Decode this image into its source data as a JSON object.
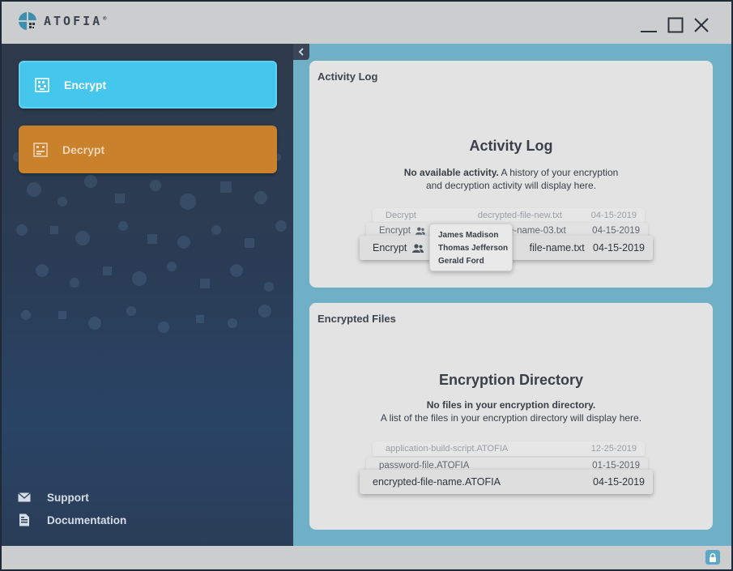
{
  "app": {
    "name": "ATOFIA",
    "registered": "®"
  },
  "window_controls": {
    "minimize": "minimize-icon",
    "maximize": "maximize-icon",
    "close": "close-icon"
  },
  "sidebar": {
    "items": [
      {
        "label": "Encrypt",
        "icon": "encrypt-icon",
        "color": "#45c6ec",
        "active": true
      },
      {
        "label": "Decrypt",
        "icon": "decrypt-icon",
        "color": "#c9822b",
        "active": false
      }
    ],
    "footer": [
      {
        "label": "Support",
        "icon": "mail-icon"
      },
      {
        "label": "Documentation",
        "icon": "document-icon"
      }
    ]
  },
  "activity": {
    "header": "Activity Log",
    "title": "Activity Log",
    "desc_bold": "No available activity.",
    "desc_line1_rest": " A history of your encryption",
    "desc_line2": "and decryption activity will display here.",
    "rows": [
      {
        "action": "Decrypt",
        "file": "decrypted-file-new.txt",
        "date": "04-15-2019"
      },
      {
        "action": "Encrypt",
        "file": "le-name-03.txt",
        "date": "04-15-2019"
      },
      {
        "action": "Encrypt",
        "file": "file-name.txt",
        "date": "04-15-2019"
      }
    ],
    "tooltip_names": [
      "James Madison",
      "Thomas Jefferson",
      "Gerald Ford"
    ]
  },
  "files": {
    "header": "Encrypted Files",
    "title": "Encryption Directory",
    "desc_bold": "No files in your encryption directory.",
    "desc_line2": "A list of the files in your encryption directory will display here.",
    "rows": [
      {
        "file": "application-build-script.ATOFIA",
        "date": "12-25-2019"
      },
      {
        "file": "password-file.ATOFIA",
        "date": "01-15-2019"
      },
      {
        "file": "encrypted-file-name.ATOFIA",
        "date": "04-15-2019"
      }
    ]
  },
  "status": {
    "lock_icon": "lock-icon",
    "accent": "#5aa8c6"
  }
}
